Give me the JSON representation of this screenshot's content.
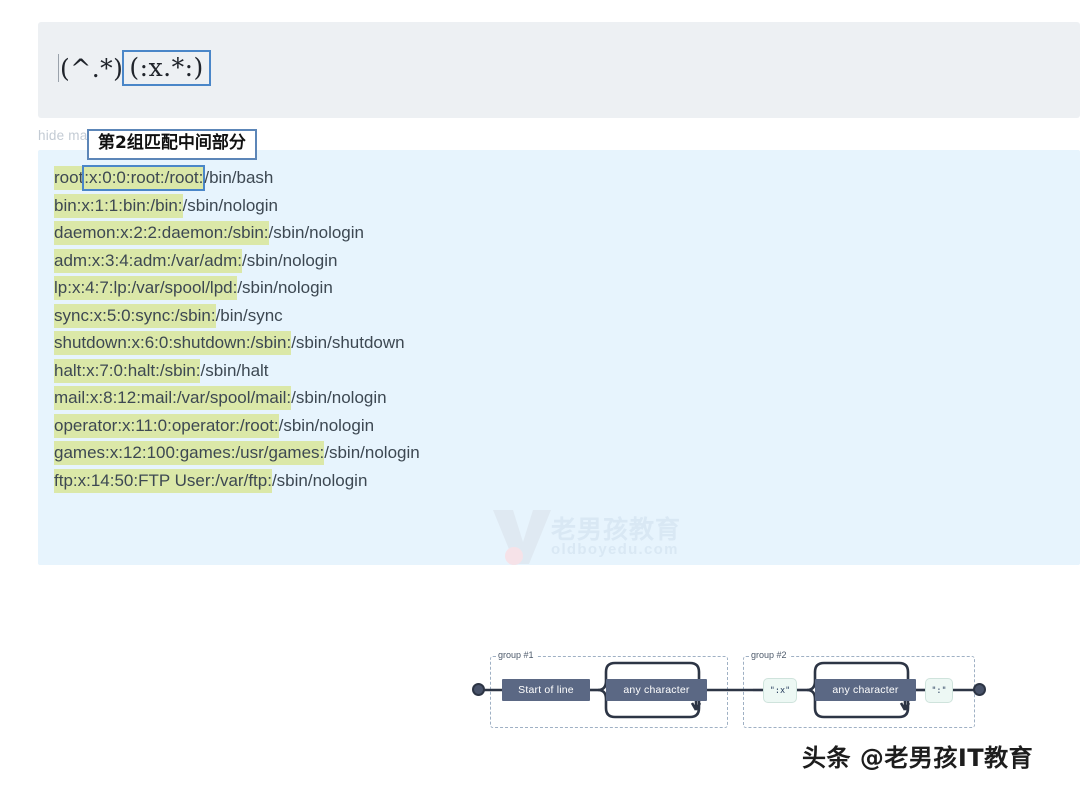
{
  "regex": {
    "full": "(^.*)(:x.*:)",
    "group1": "(^.*)",
    "group2": "(:x.*:)"
  },
  "controls": {
    "hide_matches_label": "hide matches"
  },
  "tooltip": {
    "text": "第2组匹配中间部分"
  },
  "test_text": {
    "lines": [
      {
        "match": "root:x:0:0:root:/root:",
        "rest": "/bin/bash",
        "selected": true
      },
      {
        "match": "bin:x:1:1:bin:/bin:",
        "rest": "/sbin/nologin",
        "selected": false
      },
      {
        "match": "daemon:x:2:2:daemon:/sbin:",
        "rest": "/sbin/nologin",
        "selected": false
      },
      {
        "match": "adm:x:3:4:adm:/var/adm:",
        "rest": "/sbin/nologin",
        "selected": false
      },
      {
        "match": "lp:x:4:7:lp:/var/spool/lpd:",
        "rest": "/sbin/nologin",
        "selected": false
      },
      {
        "match": "sync:x:5:0:sync:/sbin:",
        "rest": "/bin/sync",
        "selected": false
      },
      {
        "match": "shutdown:x:6:0:shutdown:/sbin:",
        "rest": "/sbin/shutdown",
        "selected": false
      },
      {
        "match": "halt:x:7:0:halt:/sbin:",
        "rest": "/sbin/halt",
        "selected": false
      },
      {
        "match": "mail:x:8:12:mail:/var/spool/mail:",
        "rest": "/sbin/nologin",
        "selected": false
      },
      {
        "match": "operator:x:11:0:operator:/root:",
        "rest": "/sbin/nologin",
        "selected": false
      },
      {
        "match": "games:x:12:100:games:/usr/games:",
        "rest": "/sbin/nologin",
        "selected": false
      },
      {
        "match": "ftp:x:14:50:FTP User:/var/ftp:",
        "rest": "/sbin/nologin",
        "selected": false
      }
    ],
    "selection": {
      "prefix": "root",
      "selected": ":x:0:0:root:/root:",
      "suffix": "/bin/bash"
    }
  },
  "watermark": {
    "cn": "老男孩教育",
    "en": "oldboyedu.com"
  },
  "footer": {
    "text": "头条 @老男孩IT教育"
  },
  "diagram": {
    "groups": [
      {
        "label": "group #1"
      },
      {
        "label": "group #2"
      }
    ],
    "nodes": [
      {
        "id": "start-of-line",
        "label": "Start of line",
        "kind": "node"
      },
      {
        "id": "any-character-1",
        "label": "any character",
        "kind": "node"
      },
      {
        "id": "literal-colon-x",
        "label": "\":x\"",
        "kind": "literal"
      },
      {
        "id": "any-character-2",
        "label": "any character",
        "kind": "node"
      },
      {
        "id": "literal-colon",
        "label": "\":\"",
        "kind": "literal"
      }
    ]
  },
  "colors": {
    "regex_panel_bg": "#edf0f3",
    "text_panel_bg": "#e7f4fd",
    "match_highlight": "#dbe8a8",
    "selection_border": "#4a86c8",
    "node_fill": "#5b6884",
    "literal_fill": "#edf8f4",
    "group_dash": "#9fb0c4"
  }
}
